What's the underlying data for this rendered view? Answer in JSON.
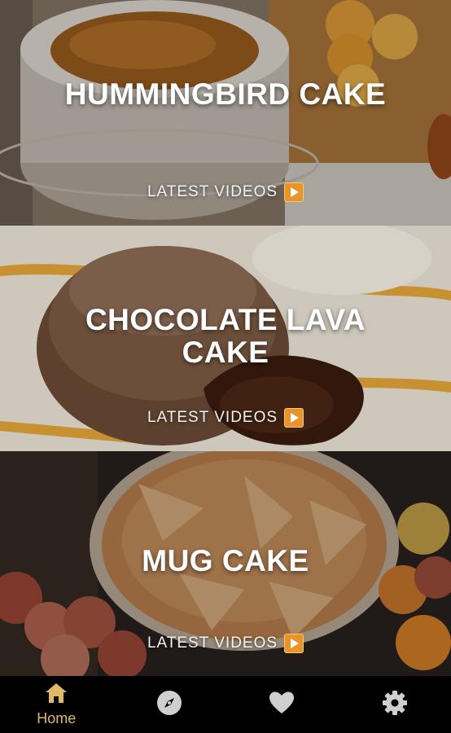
{
  "cards": [
    {
      "title": "HUMMINGBIRD CAKE",
      "cta": "LATEST VIDEOS"
    },
    {
      "title": "CHOCOLATE LAVA CAKE",
      "cta": "LATEST VIDEOS"
    },
    {
      "title": "MUG CAKE",
      "cta": "LATEST VIDEOS"
    }
  ],
  "nav": {
    "items": [
      {
        "icon": "home-icon",
        "label": "Home",
        "active": true
      },
      {
        "icon": "compass-icon",
        "label": "",
        "active": false
      },
      {
        "icon": "heart-icon",
        "label": "",
        "active": false
      },
      {
        "icon": "gear-icon",
        "label": "",
        "active": false
      }
    ]
  },
  "colors": {
    "accent": "#e0b86a",
    "play_button": "#e8942a",
    "nav_background": "#000000",
    "nav_inactive": "#cfcfcf"
  }
}
